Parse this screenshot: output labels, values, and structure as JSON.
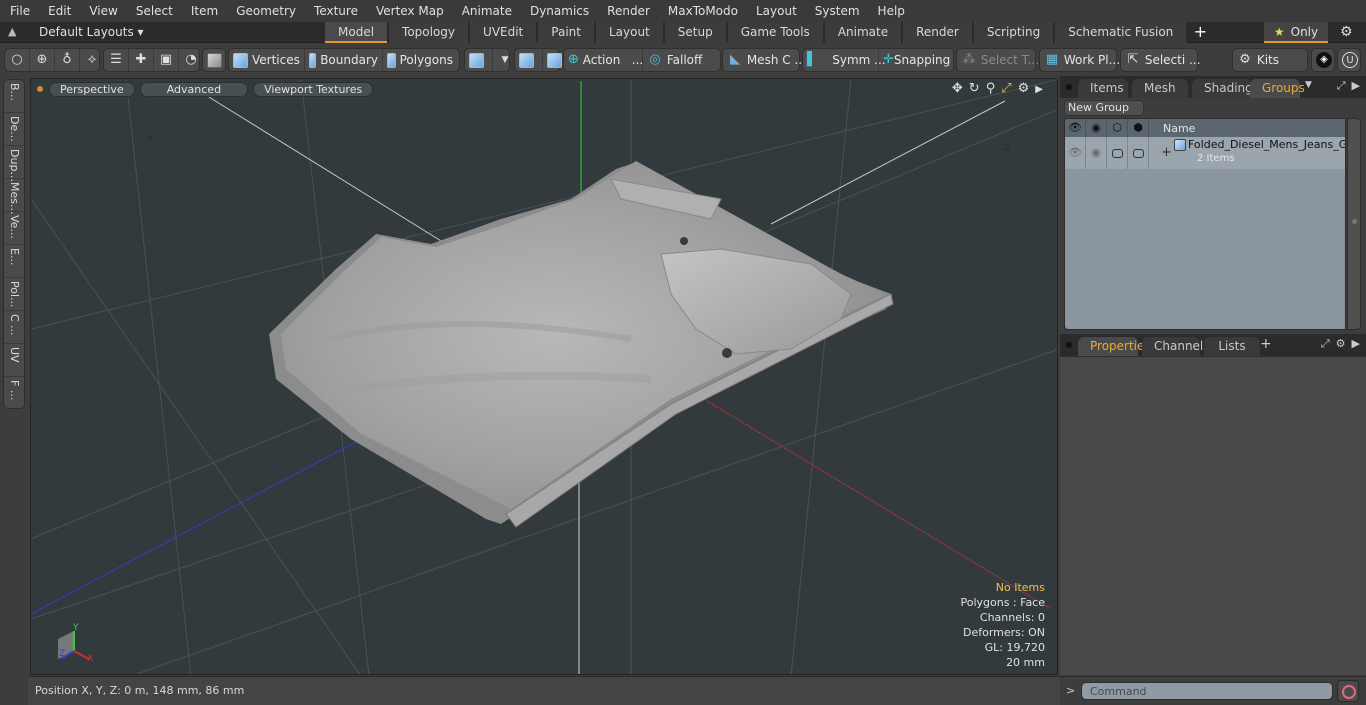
{
  "menu": [
    "File",
    "Edit",
    "View",
    "Select",
    "Item",
    "Geometry",
    "Texture",
    "Vertex Map",
    "Animate",
    "Dynamics",
    "Render",
    "MaxToModo",
    "Layout",
    "System",
    "Help"
  ],
  "layoutbar": {
    "layout_select": "Default Layouts ▾",
    "tabs": [
      "Model",
      "Topology",
      "UVEdit",
      "Paint",
      "Layout",
      "Setup",
      "Game Tools",
      "Animate",
      "Render",
      "Scripting",
      "Schematic Fusion"
    ],
    "active_tab": "Model",
    "add_tab": "+",
    "only_label": "Only"
  },
  "toolbar": {
    "vertices": "Vertices",
    "boundary": "Boundary",
    "polygons": "Polygons",
    "action": "Action",
    "action_more": "...",
    "falloff": "Falloff",
    "mesh_c": "Mesh C ...",
    "symm": "Symm ...",
    "snapping": "Snapping",
    "select_t": "Select T...",
    "work_pl": "Work Pl...",
    "selecti": "Selecti ...",
    "kits": "Kits"
  },
  "left_tabs": [
    "B...",
    "De...",
    "Dup...",
    "Mes...",
    "Ve...",
    "E...",
    "Pol...",
    "C ...",
    "UV",
    "F ..."
  ],
  "viewport": {
    "pills": [
      "Perspective",
      "Advanced",
      "Viewport Textures"
    ],
    "axis_labels": {
      "x": "X",
      "y": "Y",
      "z": "Z",
      "neg_x": "-X",
      "neg_z": "-Z"
    },
    "info": {
      "items": "No Items",
      "polygons": "Polygons : Face",
      "channels": "Channels: 0",
      "deformers": "Deformers: ON",
      "gl": "GL: 19,720",
      "scale": "20 mm"
    },
    "colors": {
      "bg": "#323a3e",
      "x_axis": "#c83030",
      "y_axis": "#30d040",
      "z_axis": "#3040c0",
      "highlight": "#f0c050"
    }
  },
  "groups_panel": {
    "tabs": [
      "Items",
      "Mesh ...",
      "Shading",
      "Groups"
    ],
    "active_tab": "Groups",
    "new_group": "New Group",
    "column_name": "Name",
    "rows": [
      {
        "name": "Folded_Diesel_Mens_Jeans_G...",
        "sub": "2 Items",
        "expand": "+"
      }
    ]
  },
  "properties_panel": {
    "tabs": [
      "Properties",
      "Channels",
      "Lists"
    ],
    "active_tab": "Properties",
    "add_tab": "+"
  },
  "statusbar": {
    "position": "Position X, Y, Z:   0 m, 148 mm, 86 mm"
  },
  "command": {
    "prompt": ">",
    "placeholder": "Command"
  }
}
